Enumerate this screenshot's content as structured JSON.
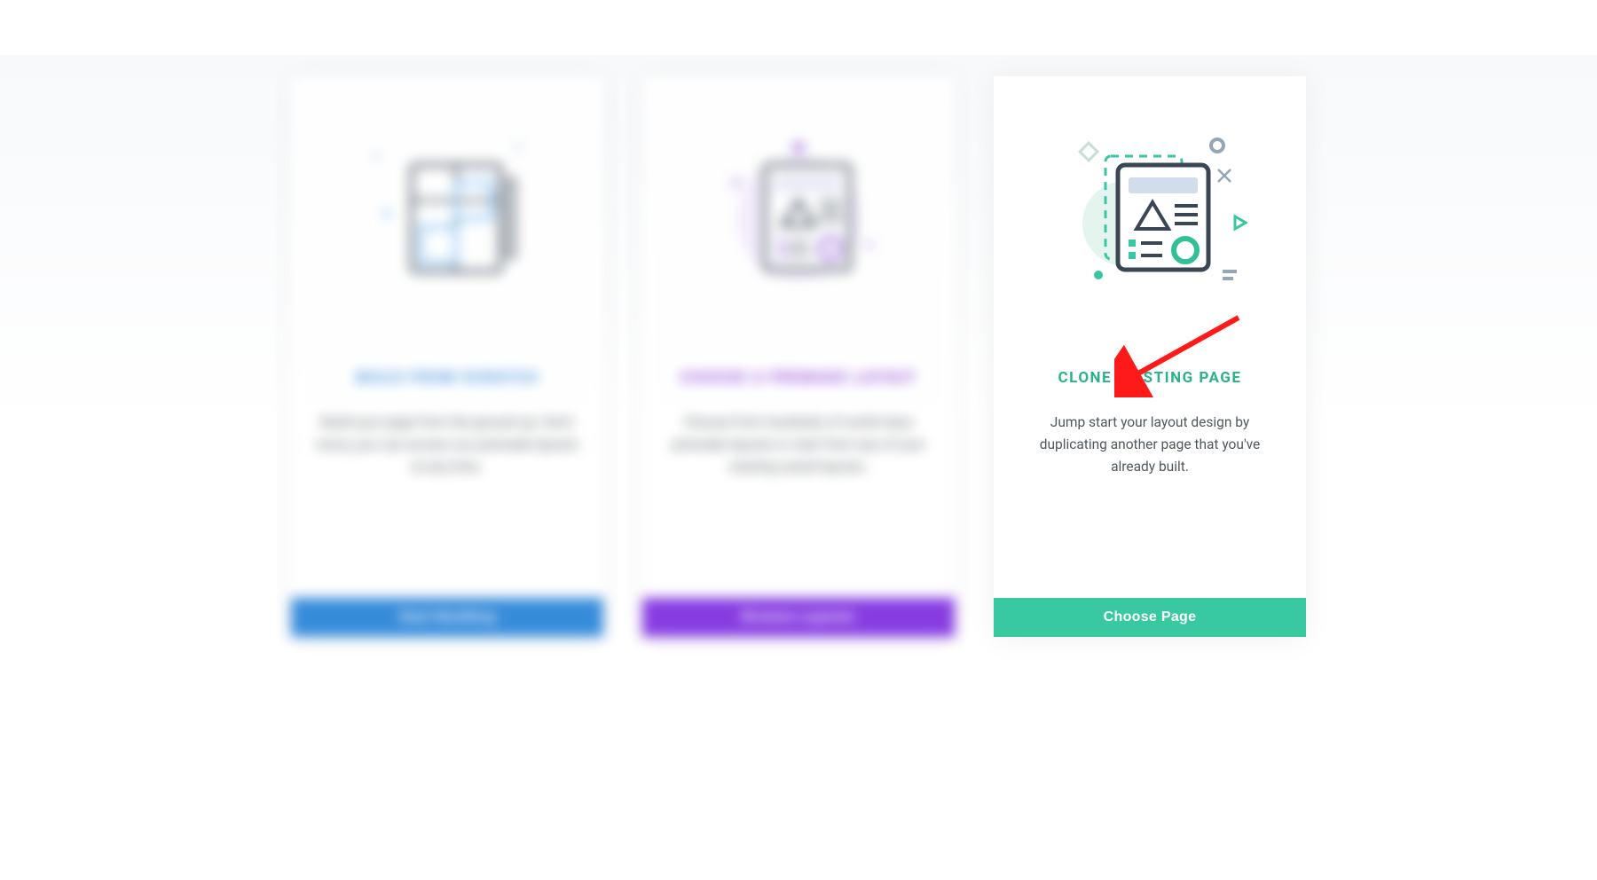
{
  "cards": [
    {
      "title": "BUILD FROM SCRATCH",
      "description": "Build your page from the ground up. Don't worry, you can access our premade layouts at any time.",
      "button": "Start Building"
    },
    {
      "title": "CHOOSE A PREMADE LAYOUT",
      "description": "Choose from hundreds of world-class premade layouts or start from any of your existing saved layouts.",
      "button": "Browse Layouts"
    },
    {
      "title": "CLONE EXISTING PAGE",
      "description": "Jump start your layout design by duplicating another page that you've already built.",
      "button": "Choose Page"
    }
  ],
  "colors": {
    "blue": "#2d86d9",
    "purple": "#8132e0",
    "teal": "#38c9a0"
  },
  "annotation": {
    "type": "arrow",
    "color": "#ff0000",
    "target": "clone-card-title"
  }
}
